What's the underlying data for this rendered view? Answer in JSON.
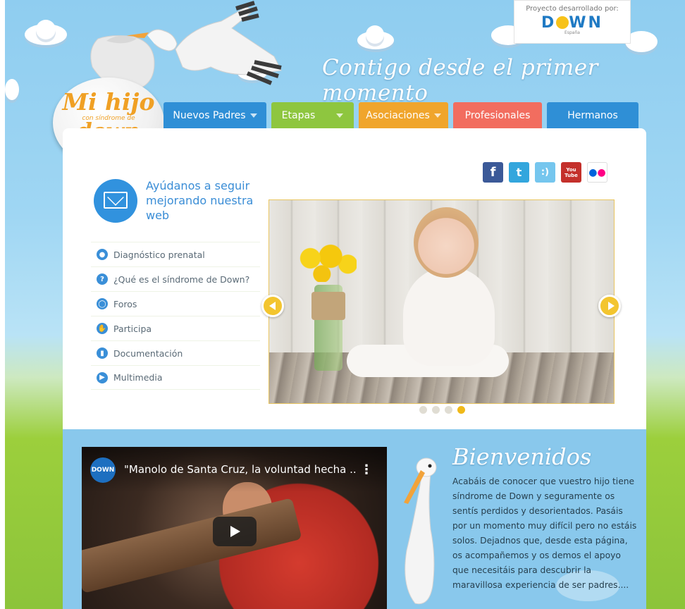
{
  "sponsor": {
    "caption": "Proyecto desarrollado por:",
    "logo_text_pre": "D",
    "logo_text_post": "WN",
    "logo_sub": "España"
  },
  "header": {
    "tagline": "Contigo desde el primer momento",
    "logo": {
      "line1": "Mi hijo",
      "line2": "con síndrome de",
      "line3": "down"
    }
  },
  "nav": {
    "items": [
      {
        "label": "Nuevos Padres",
        "color": "#2f8fd6",
        "dropdown": true
      },
      {
        "label": "Etapas",
        "color": "#8ec63f",
        "dropdown": true
      },
      {
        "label": "Asociaciones",
        "color": "#f0a52c",
        "dropdown": true
      },
      {
        "label": "Profesionales",
        "color": "#f26d5f",
        "dropdown": false
      },
      {
        "label": "Hermanos",
        "color": "#2f8fd6",
        "dropdown": false
      }
    ]
  },
  "promo": {
    "text": "Ayúdanos a seguir mejorando nuestra web",
    "icon": "envelope-icon"
  },
  "menu": {
    "items": [
      {
        "label": "Diagnóstico prenatal",
        "icon": "baby-icon"
      },
      {
        "label": "¿Qué es el síndrome de Down?",
        "icon": "question-icon"
      },
      {
        "label": "Foros",
        "icon": "chat-icon"
      },
      {
        "label": "Participa",
        "icon": "hand-icon"
      },
      {
        "label": "Documentación",
        "icon": "document-icon"
      },
      {
        "label": "Multimedia",
        "icon": "video-icon"
      }
    ]
  },
  "social": [
    {
      "name": "facebook",
      "glyph": "f",
      "color": "#3b5998"
    },
    {
      "name": "twitter",
      "glyph": "t",
      "color": "#33a6dd"
    },
    {
      "name": "blog",
      "glyph": ":)",
      "color": "#75c6ee"
    },
    {
      "name": "youtube",
      "glyph": "You Tube",
      "color": "#c4302b"
    },
    {
      "name": "flickr",
      "glyph": "●●",
      "color": "#ffffff"
    }
  ],
  "slider": {
    "slide_count": 4,
    "active_slide": 4
  },
  "video": {
    "title": "\"Manolo de Santa Cruz, la voluntad hecha ...",
    "channel": "DOWN"
  },
  "welcome": {
    "heading": "Bienvenidos",
    "body": "Acabáis de conocer que vuestro hijo tiene síndrome de Down y seguramente os sentís perdidos y desorientados. Pasáis por un momento muy difícil pero no estáis solos. Dejadnos que, desde esta página, os acompañemos y os demos el apoyo que necesitáis para descubrir la maravillosa experiencia de ser padres...."
  }
}
